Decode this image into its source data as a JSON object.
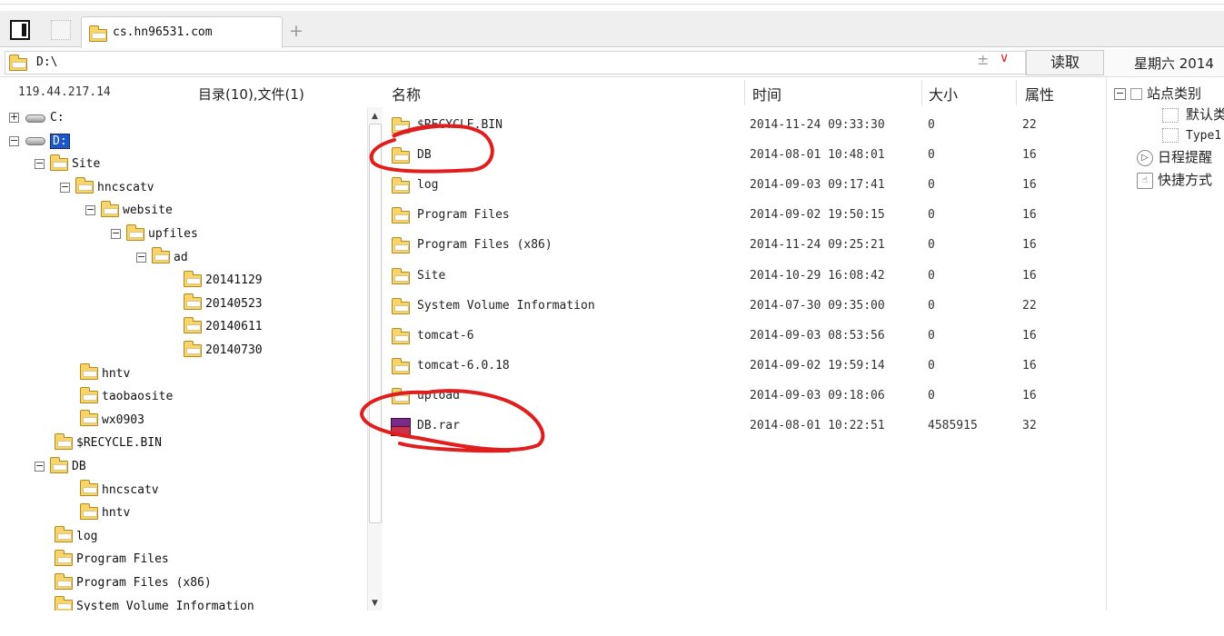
{
  "tabs": {
    "active_label": "cs.hn96531.com",
    "add_symbol": "+"
  },
  "address": {
    "path": "D:\\",
    "plusminus": "±",
    "chevron": "∨",
    "read_button": "读取",
    "date": "星期六 2014"
  },
  "server": {
    "ip": "119.44.217.14",
    "counts": "目录(10),文件(1)"
  },
  "columns": {
    "name": "名称",
    "time": "时间",
    "size": "大小",
    "attr": "属性"
  },
  "tree": [
    {
      "label": "C:",
      "type": "drive",
      "expander": "+"
    },
    {
      "label": "D:",
      "type": "drive",
      "expander": "−",
      "selected": true
    },
    {
      "label": "Site",
      "type": "folder",
      "expander": "−"
    },
    {
      "label": "hncscatv",
      "type": "folder",
      "expander": "−"
    },
    {
      "label": "website",
      "type": "folder",
      "expander": "−"
    },
    {
      "label": "upfiles",
      "type": "folder",
      "expander": "−"
    },
    {
      "label": "ad",
      "type": "folder",
      "expander": "−"
    },
    {
      "label": "20141129",
      "type": "folder"
    },
    {
      "label": "20140523",
      "type": "folder"
    },
    {
      "label": "20140611",
      "type": "folder"
    },
    {
      "label": "20140730",
      "type": "folder"
    },
    {
      "label": "hntv",
      "type": "folder"
    },
    {
      "label": "taobaosite",
      "type": "folder"
    },
    {
      "label": "wx0903",
      "type": "folder"
    },
    {
      "label": "$RECYCLE.BIN",
      "type": "folder"
    },
    {
      "label": "DB",
      "type": "folder",
      "expander": "−"
    },
    {
      "label": "hncscatv",
      "type": "folder"
    },
    {
      "label": "hntv",
      "type": "folder"
    },
    {
      "label": "log",
      "type": "folder"
    },
    {
      "label": "Program Files",
      "type": "folder"
    },
    {
      "label": "Program Files (x86)",
      "type": "folder"
    },
    {
      "label": "System Volume Information",
      "type": "folder"
    }
  ],
  "files": [
    {
      "name": "$RECYCLE.BIN",
      "time": "2014-11-24 09:33:30",
      "size": "0",
      "attr": "22",
      "type": "folder"
    },
    {
      "name": "DB",
      "time": "2014-08-01 10:48:01",
      "size": "0",
      "attr": "16",
      "type": "folder"
    },
    {
      "name": "log",
      "time": "2014-09-03 09:17:41",
      "size": "0",
      "attr": "16",
      "type": "folder"
    },
    {
      "name": "Program Files",
      "time": "2014-09-02 19:50:15",
      "size": "0",
      "attr": "16",
      "type": "folder"
    },
    {
      "name": "Program Files (x86)",
      "time": "2014-11-24 09:25:21",
      "size": "0",
      "attr": "16",
      "type": "folder"
    },
    {
      "name": "Site",
      "time": "2014-10-29 16:08:42",
      "size": "0",
      "attr": "16",
      "type": "folder"
    },
    {
      "name": "System Volume Information",
      "time": "2014-07-30 09:35:00",
      "size": "0",
      "attr": "22",
      "type": "folder"
    },
    {
      "name": "tomcat-6",
      "time": "2014-09-03 08:53:56",
      "size": "0",
      "attr": "16",
      "type": "folder"
    },
    {
      "name": "tomcat-6.0.18",
      "time": "2014-09-02 19:59:14",
      "size": "0",
      "attr": "16",
      "type": "folder"
    },
    {
      "name": "upload",
      "time": "2014-09-03 09:18:06",
      "size": "0",
      "attr": "16",
      "type": "folder"
    },
    {
      "name": "DB.rar",
      "time": "2014-08-01 10:22:51",
      "size": "4585915",
      "attr": "32",
      "type": "rar"
    }
  ],
  "sidebar": {
    "site_category": "站点类别",
    "default_item": "默认类",
    "type_item": "Type1",
    "schedule": "日程提醒",
    "shortcuts": "快捷方式"
  },
  "colors": {
    "accent_selected": "#1e57c8",
    "annotation_red": "#e01e1e",
    "folder_yellow": "#f7d56a"
  }
}
